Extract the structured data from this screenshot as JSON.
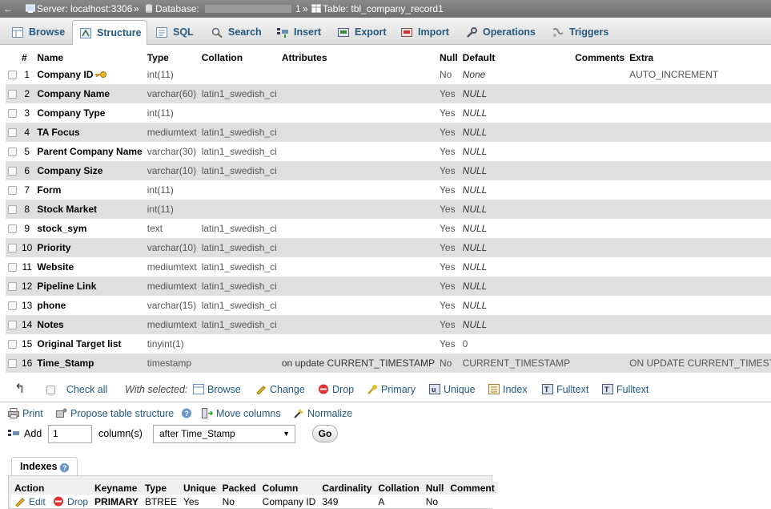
{
  "breadcrumb": {
    "server": "Server: localhost:3306",
    "sep1": "»",
    "database_label": "Database:",
    "database_name": "1",
    "sep2": "»",
    "table": "Table: tbl_company_record1"
  },
  "tabs": [
    {
      "label": "Browse",
      "icon": "browse-icon"
    },
    {
      "label": "Structure",
      "icon": "structure-icon",
      "active": true
    },
    {
      "label": "SQL",
      "icon": "sql-icon"
    },
    {
      "label": "Search",
      "icon": "search-icon"
    },
    {
      "label": "Insert",
      "icon": "insert-icon"
    },
    {
      "label": "Export",
      "icon": "export-icon"
    },
    {
      "label": "Import",
      "icon": "import-icon"
    },
    {
      "label": "Operations",
      "icon": "wrench-icon"
    },
    {
      "label": "Triggers",
      "icon": "triggers-icon"
    }
  ],
  "columns_header": {
    "num": "#",
    "name": "Name",
    "type": "Type",
    "collation": "Collation",
    "attributes": "Attributes",
    "null": "Null",
    "default": "Default",
    "comments": "Comments",
    "extra": "Extra"
  },
  "rows": [
    {
      "num": "1",
      "name": "Company ID",
      "type": "int(11)",
      "collation": "",
      "attributes": "",
      "null": "No",
      "default": "None",
      "extra": "AUTO_INCREMENT"
    },
    {
      "num": "2",
      "name": "Company Name",
      "type": "varchar(60)",
      "collation": "latin1_swedish_ci",
      "attributes": "",
      "null": "Yes",
      "default": "NULL",
      "extra": ""
    },
    {
      "num": "3",
      "name": "Company Type",
      "type": "int(11)",
      "collation": "",
      "attributes": "",
      "null": "Yes",
      "default": "NULL",
      "extra": ""
    },
    {
      "num": "4",
      "name": "TA Focus",
      "type": "mediumtext",
      "collation": "latin1_swedish_ci",
      "attributes": "",
      "null": "Yes",
      "default": "NULL",
      "extra": ""
    },
    {
      "num": "5",
      "name": "Parent Company Name",
      "type": "varchar(30)",
      "collation": "latin1_swedish_ci",
      "attributes": "",
      "null": "Yes",
      "default": "NULL",
      "extra": ""
    },
    {
      "num": "6",
      "name": "Company Size",
      "type": "varchar(10)",
      "collation": "latin1_swedish_ci",
      "attributes": "",
      "null": "Yes",
      "default": "NULL",
      "extra": ""
    },
    {
      "num": "7",
      "name": "Form",
      "type": "int(11)",
      "collation": "",
      "attributes": "",
      "null": "Yes",
      "default": "NULL",
      "extra": ""
    },
    {
      "num": "8",
      "name": "Stock Market",
      "type": "int(11)",
      "collation": "",
      "attributes": "",
      "null": "Yes",
      "default": "NULL",
      "extra": ""
    },
    {
      "num": "9",
      "name": "stock_sym",
      "type": "text",
      "collation": "latin1_swedish_ci",
      "attributes": "",
      "null": "Yes",
      "default": "NULL",
      "extra": ""
    },
    {
      "num": "10",
      "name": "Priority",
      "type": "varchar(10)",
      "collation": "latin1_swedish_ci",
      "attributes": "",
      "null": "Yes",
      "default": "NULL",
      "extra": ""
    },
    {
      "num": "11",
      "name": "Website",
      "type": "mediumtext",
      "collation": "latin1_swedish_ci",
      "attributes": "",
      "null": "Yes",
      "default": "NULL",
      "extra": ""
    },
    {
      "num": "12",
      "name": "Pipeline Link",
      "type": "mediumtext",
      "collation": "latin1_swedish_ci",
      "attributes": "",
      "null": "Yes",
      "default": "NULL",
      "extra": ""
    },
    {
      "num": "13",
      "name": "phone",
      "type": "varchar(15)",
      "collation": "latin1_swedish_ci",
      "attributes": "",
      "null": "Yes",
      "default": "NULL",
      "extra": ""
    },
    {
      "num": "14",
      "name": "Notes",
      "type": "mediumtext",
      "collation": "latin1_swedish_ci",
      "attributes": "",
      "null": "Yes",
      "default": "NULL",
      "extra": ""
    },
    {
      "num": "15",
      "name": "Original Target list",
      "type": "tinyint(1)",
      "collation": "",
      "attributes": "",
      "null": "Yes",
      "default": "0",
      "extra": ""
    },
    {
      "num": "16",
      "name": "Time_Stamp",
      "type": "timestamp",
      "collation": "",
      "attributes": "on update CURRENT_TIMESTAMP",
      "null": "No",
      "default": "CURRENT_TIMESTAMP",
      "extra": "ON UPDATE CURRENT_TIMESTAMP"
    }
  ],
  "with_selected": {
    "check_all": "Check all",
    "label": "With selected:",
    "browse": "Browse",
    "change": "Change",
    "drop": "Drop",
    "primary": "Primary",
    "unique": "Unique",
    "index": "Index",
    "fulltext1": "Fulltext",
    "fulltext2": "Fulltext"
  },
  "tools": {
    "print": "Print",
    "propose": "Propose table structure",
    "move": "Move columns",
    "normalize": "Normalize"
  },
  "add_columns": {
    "label": "Add",
    "count": "1",
    "unit": "column(s)",
    "position": "after Time_Stamp",
    "go": "Go"
  },
  "indexes": {
    "title": "Indexes",
    "headers": [
      "Action",
      "Keyname",
      "Type",
      "Unique",
      "Packed",
      "Column",
      "Cardinality",
      "Collation",
      "Null",
      "Comment"
    ],
    "row": {
      "edit": "Edit",
      "drop": "Drop",
      "keyname": "PRIMARY",
      "type": "BTREE",
      "unique": "Yes",
      "packed": "No",
      "column": "Company ID",
      "cardinality": "349",
      "collation": "A",
      "null": "No",
      "comment": ""
    }
  }
}
